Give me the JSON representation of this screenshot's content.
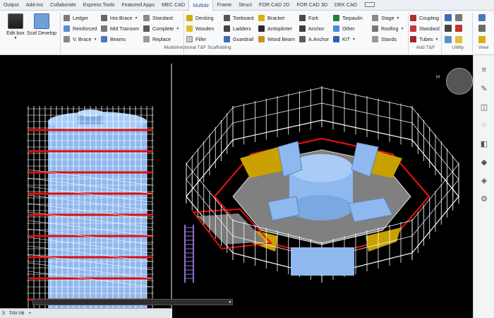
{
  "tabs": [
    "Output",
    "Add-ins",
    "Collaborate",
    "Express Tools",
    "Featured Apps",
    "MEC CAD",
    "Multidir",
    "Frame",
    "Struct",
    "FOR CAD 2D",
    "FOR CAD 3D",
    "DEK CAD"
  ],
  "active_tab": "Multidir",
  "ribbon": {
    "edit_box": "Edit box",
    "scaf_develop": "Scaf Develop",
    "col1": [
      "Ledger",
      "Reinforced",
      "V. Brace"
    ],
    "col2": [
      "Hor.Brace",
      "Mid Transom",
      "Beams"
    ],
    "col3": [
      "Standard",
      "Complete",
      "Replace"
    ],
    "col4": [
      "Decking",
      "Wooden",
      "Filler"
    ],
    "col5": [
      "Toeboard",
      "Ladders",
      "Guardrail"
    ],
    "col6": [
      "Bracket",
      "Antisplinter",
      "Wood Beam"
    ],
    "col7": [
      "Fork",
      "Anchor",
      "A.Anchor"
    ],
    "col8": [
      "Tarpaulin",
      "Other",
      "KIT"
    ],
    "col9": [
      "Stage",
      "Roofing",
      "Stands"
    ],
    "col10": [
      "Coupling",
      "Standard",
      "Tubes"
    ],
    "group_main": "Multidirectional  T&F Scaffolding",
    "group_addtf": "Add T&F",
    "group_utility": "Utility",
    "group_view": "View"
  },
  "status": {
    "left_value": "3",
    "layout": "TAV 06"
  },
  "compass_label": "H",
  "colors": {
    "accent": "#2b5797",
    "scaffold": "#ffffff",
    "toeboard": "#e01010",
    "tank": "#8fb8ee",
    "decking": "#888888",
    "boards": "#c8a000",
    "ladder": "#9070d0"
  }
}
